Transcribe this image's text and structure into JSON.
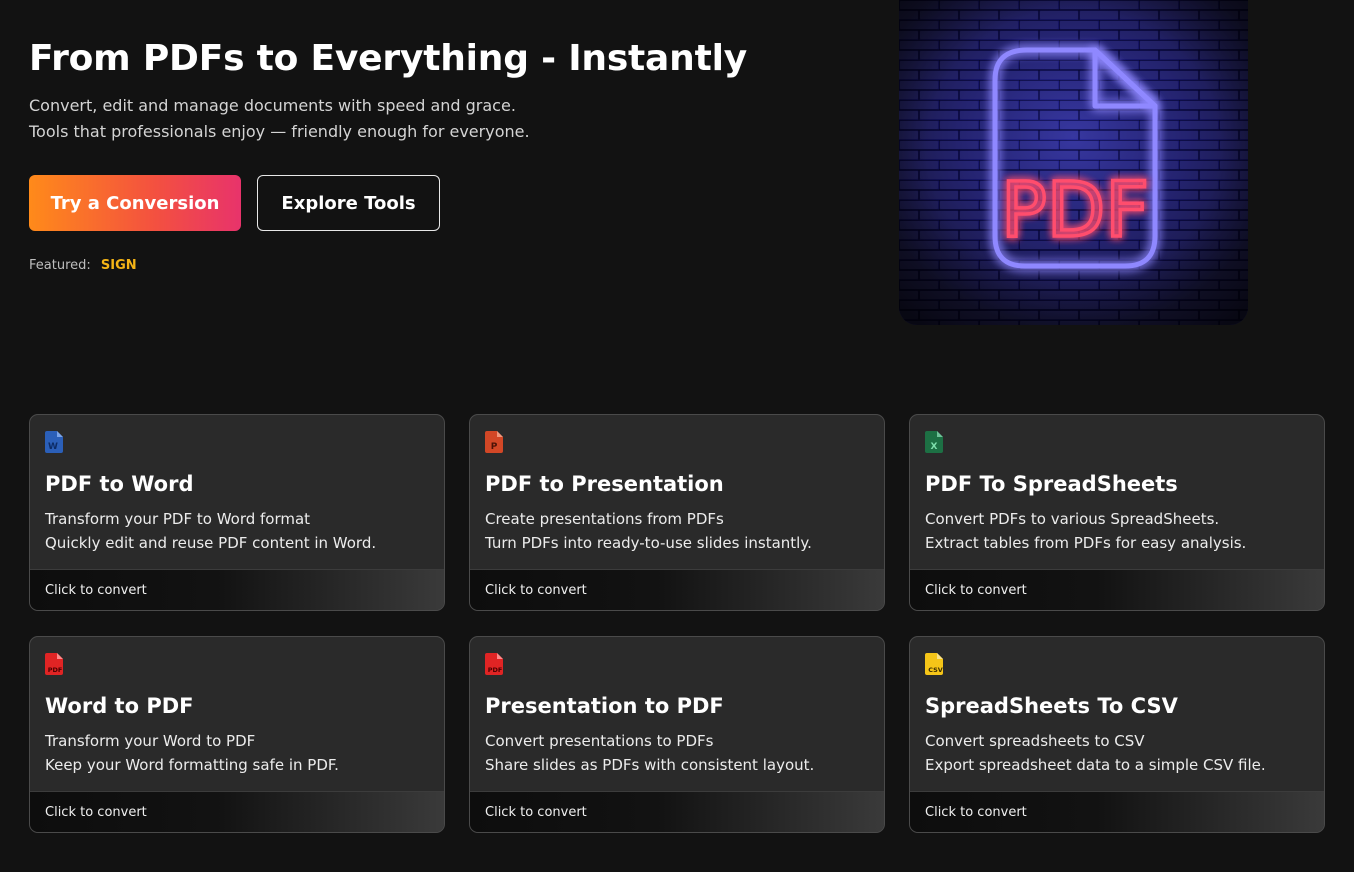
{
  "hero": {
    "title": "From PDFs to Everything - Instantly",
    "subtitle_line1": "Convert, edit and manage documents with speed and grace.",
    "subtitle_line2": "Tools that professionals enjoy — friendly enough for everyone.",
    "primary_button": "Try a Conversion",
    "secondary_button": "Explore Tools",
    "featured_label": "Featured:",
    "featured_value": "SIGN",
    "image_text": "PDF",
    "image_icon": "neon-pdf-file-icon"
  },
  "colors": {
    "background": "#121212",
    "card_bg": "#2a2a2a",
    "accent_start": "#ff8a1a",
    "accent_end": "#e8336b",
    "featured": "#f4b416",
    "word": "#2b5fb8",
    "powerpoint": "#d24726",
    "excel": "#1d7044",
    "pdf": "#e02424",
    "csv": "#f5c518"
  },
  "cards": [
    {
      "icon": "word-file-icon",
      "icon_letter": "W",
      "title": "PDF to Word",
      "line1": "Transform your PDF to Word format",
      "line2": "Quickly edit and reuse PDF content in Word.",
      "footer": "Click to convert"
    },
    {
      "icon": "powerpoint-file-icon",
      "icon_letter": "P",
      "title": "PDF to Presentation",
      "line1": "Create presentations from PDFs",
      "line2": "Turn PDFs into ready-to-use slides instantly.",
      "footer": "Click to convert"
    },
    {
      "icon": "excel-file-icon",
      "icon_letter": "X",
      "title": "PDF To SpreadSheets",
      "line1": "Convert PDFs to various SpreadSheets.",
      "line2": "Extract tables from PDFs for easy analysis.",
      "footer": "Click to convert"
    },
    {
      "icon": "pdf-file-icon",
      "icon_letter": "PDF",
      "title": "Word to PDF",
      "line1": "Transform your Word to PDF",
      "line2": "Keep your Word formatting safe in PDF.",
      "footer": "Click to convert"
    },
    {
      "icon": "pdf-file-icon",
      "icon_letter": "PDF",
      "title": "Presentation to PDF",
      "line1": "Convert presentations to PDFs",
      "line2": "Share slides as PDFs with consistent layout.",
      "footer": "Click to convert"
    },
    {
      "icon": "csv-file-icon",
      "icon_letter": "CSV",
      "title": "SpreadSheets To CSV",
      "line1": "Convert spreadsheets to CSV",
      "line2": "Export spreadsheet data to a simple CSV file.",
      "footer": "Click to convert"
    }
  ]
}
